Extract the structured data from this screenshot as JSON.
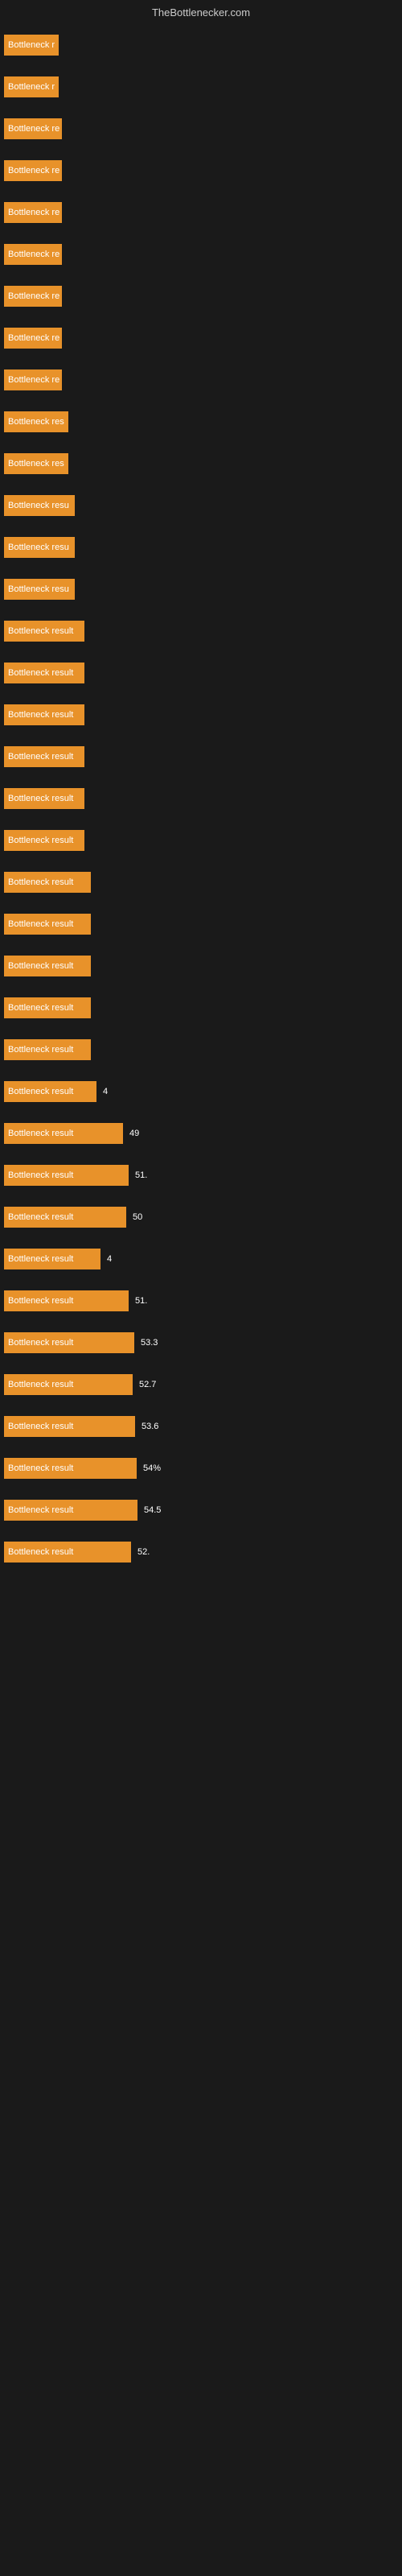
{
  "header": {
    "title": "TheBottlenecker.com"
  },
  "bars": [
    {
      "label": "Bottleneck r",
      "width": 68,
      "value": ""
    },
    {
      "label": "Bottleneck r",
      "width": 68,
      "value": ""
    },
    {
      "label": "Bottleneck re",
      "width": 72,
      "value": ""
    },
    {
      "label": "Bottleneck re",
      "width": 72,
      "value": ""
    },
    {
      "label": "Bottleneck re",
      "width": 72,
      "value": ""
    },
    {
      "label": "Bottleneck re",
      "width": 72,
      "value": ""
    },
    {
      "label": "Bottleneck re",
      "width": 72,
      "value": ""
    },
    {
      "label": "Bottleneck re",
      "width": 72,
      "value": ""
    },
    {
      "label": "Bottleneck re",
      "width": 72,
      "value": ""
    },
    {
      "label": "Bottleneck res",
      "width": 80,
      "value": ""
    },
    {
      "label": "Bottleneck res",
      "width": 80,
      "value": ""
    },
    {
      "label": "Bottleneck resu",
      "width": 88,
      "value": ""
    },
    {
      "label": "Bottleneck resu",
      "width": 88,
      "value": ""
    },
    {
      "label": "Bottleneck resu",
      "width": 88,
      "value": ""
    },
    {
      "label": "Bottleneck result",
      "width": 100,
      "value": ""
    },
    {
      "label": "Bottleneck result",
      "width": 100,
      "value": ""
    },
    {
      "label": "Bottleneck result",
      "width": 100,
      "value": ""
    },
    {
      "label": "Bottleneck result",
      "width": 100,
      "value": ""
    },
    {
      "label": "Bottleneck result",
      "width": 100,
      "value": ""
    },
    {
      "label": "Bottleneck result",
      "width": 100,
      "value": ""
    },
    {
      "label": "Bottleneck result",
      "width": 108,
      "value": ""
    },
    {
      "label": "Bottleneck result",
      "width": 108,
      "value": ""
    },
    {
      "label": "Bottleneck result",
      "width": 108,
      "value": ""
    },
    {
      "label": "Bottleneck result",
      "width": 108,
      "value": ""
    },
    {
      "label": "Bottleneck result",
      "width": 108,
      "value": ""
    },
    {
      "label": "Bottleneck result",
      "width": 115,
      "value": "4"
    },
    {
      "label": "Bottleneck result",
      "width": 148,
      "value": "49"
    },
    {
      "label": "Bottleneck result",
      "width": 155,
      "value": "51."
    },
    {
      "label": "Bottleneck result",
      "width": 152,
      "value": "50"
    },
    {
      "label": "Bottleneck result",
      "width": 120,
      "value": "4"
    },
    {
      "label": "Bottleneck result",
      "width": 155,
      "value": "51."
    },
    {
      "label": "Bottleneck result",
      "width": 162,
      "value": "53.3"
    },
    {
      "label": "Bottleneck result",
      "width": 160,
      "value": "52.7"
    },
    {
      "label": "Bottleneck result",
      "width": 163,
      "value": "53.6"
    },
    {
      "label": "Bottleneck result",
      "width": 165,
      "value": "54%"
    },
    {
      "label": "Bottleneck result",
      "width": 166,
      "value": "54.5"
    },
    {
      "label": "Bottleneck result",
      "width": 158,
      "value": "52."
    }
  ]
}
